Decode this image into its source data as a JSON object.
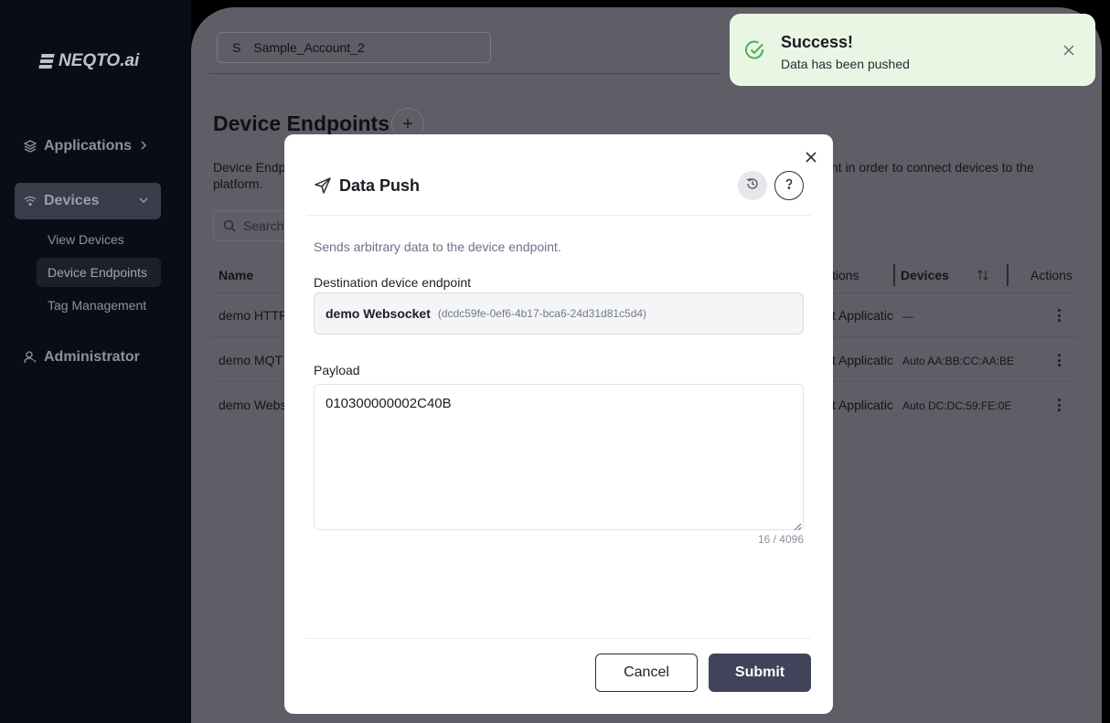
{
  "sidebar": {
    "logo_text": "NEQTO.ai",
    "items": [
      {
        "label": "Applications",
        "icon": "layers-icon"
      },
      {
        "label": "Devices",
        "icon": "wifi-icon"
      },
      {
        "label": "Administrator",
        "icon": "user-icon"
      }
    ],
    "sub_items": [
      {
        "label": "View Devices"
      },
      {
        "label": "Device Endpoints"
      },
      {
        "label": "Tag Management"
      }
    ]
  },
  "header": {
    "account_letter": "S",
    "account_name": "Sample_Account_2"
  },
  "page": {
    "title": "Device Endpoints",
    "add_label": "+",
    "description_left": "Device Endp platform.",
    "description_right": "nt in order to connect devices to the",
    "search_placeholder": "Search"
  },
  "table": {
    "columns": [
      "Name",
      "tions",
      "Devices",
      "Actions"
    ],
    "rows": [
      {
        "name": "demo HTTP",
        "application": "t Applicatic",
        "devices": "—"
      },
      {
        "name": "demo MQT",
        "application": "t Applicatic",
        "devices": "Auto AA:BB:CC:AA:BE"
      },
      {
        "name": "demo Webs",
        "application": "t Applicatic",
        "devices": "Auto DC:DC:59:FE:0E"
      }
    ]
  },
  "toast": {
    "title": "Success!",
    "message": "Data has been pushed",
    "icon": "check-circle-icon"
  },
  "modal": {
    "title": "Data Push",
    "description": "Sends arbitrary data to the device endpoint.",
    "destination_label": "Destination device endpoint",
    "destination_name": "demo Websocket",
    "destination_id": "(dcdc59fe-0ef6-4b17-bca6-24d31d81c5d4)",
    "payload_label": "Payload",
    "payload_value": "010300000002C40B",
    "char_count": "16 / 4096",
    "cancel_label": "Cancel",
    "submit_label": "Submit"
  },
  "colors": {
    "sidebar_bg": "#0b0d16",
    "overlay_main": "#5d5e66",
    "submit_bg": "#40435a",
    "toast_bg": "#eaf6e4",
    "success_green": "#4caf50"
  }
}
